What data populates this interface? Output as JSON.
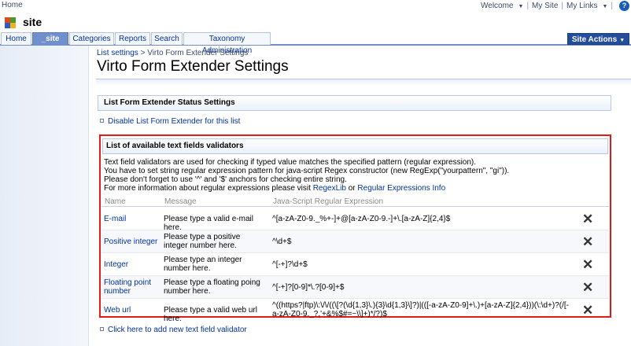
{
  "globalbar": {
    "home": "Home",
    "welcome": "Welcome",
    "my_site": "My Site",
    "my_links": "My Links",
    "help_icon": "?"
  },
  "site": {
    "title": "site"
  },
  "topnav": {
    "tabs": [
      {
        "label": "Home"
      },
      {
        "label": "_site"
      },
      {
        "label": "Categories"
      },
      {
        "label": "Reports"
      },
      {
        "label": "Search"
      },
      {
        "label": "Taxonomy Administration"
      }
    ],
    "site_actions": "Site Actions"
  },
  "breadcrumb": {
    "link": "List settings",
    "sep": ">",
    "current": "Virto Form Extender Settings"
  },
  "page_title": "Virto Form Extender Settings",
  "status_section": {
    "title": "List Form Extender Status Settings",
    "link": "Disable List Form Extender for this list"
  },
  "validators": {
    "title": "List of available text fields validators",
    "desc_lines": [
      "Text field validators are used for checking if typed value matches the specified pattern (regular expression).",
      "You have to set string regular expression pattern for java-script Regex constructor (new RegExp(\"yourpattern\", \"gi\")).",
      "Please don't forget to use '^' and '$' anchors for checking entire string."
    ],
    "desc_more_prefix": "For more information about regular expressions please visit",
    "link1": "RegexLib",
    "desc_or": "or",
    "link2": "Regular Expressions Info",
    "columns": {
      "name": "Name",
      "message": "Message",
      "regex": "Java-Script Regular Expression"
    },
    "rows": [
      {
        "name": "E-mail",
        "message": "Please type a valid e-mail here.",
        "regex": "^[a-zA-Z0-9._%+-]+@[a-zA-Z0-9.-]+\\.[a-zA-Z]{2,4}$"
      },
      {
        "name": "Positive integer",
        "message": "Please type a positive integer number here.",
        "regex": "^\\d+$"
      },
      {
        "name": "Integer",
        "message": "Please type an integer number here.",
        "regex": "^[-+]?\\d+$"
      },
      {
        "name": "Floating point number",
        "message": "Please type a floating poing number here.",
        "regex": "^[-+]?[0-9]*\\.?[0-9]+$"
      },
      {
        "name": "Web url",
        "message": "Please type a valid web url here.",
        "regex": "^((https?|ftp)\\:\\/\\/((\\[?(\\d{1,3}\\.){3}\\d{1,3}\\]?)|(([-a-zA-Z0-9]+\\.)+[a-zA-Z]{2,4}))(\\:\\d+)?(/[-a-zA-Z0-9._?,'+&%$#=~\\\\]+)*/?)$"
      }
    ],
    "delete_glyph": "✕"
  },
  "add_link": "Click here to add new text field validator"
}
